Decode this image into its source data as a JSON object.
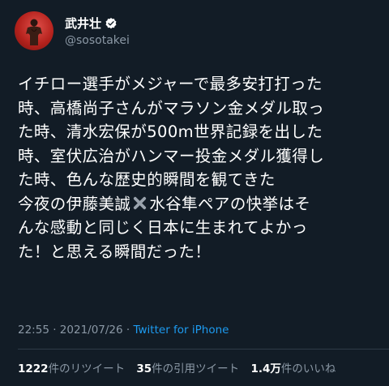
{
  "user": {
    "display_name": "武井壮",
    "handle": "@sosotakei"
  },
  "tweet": {
    "lines": [
      "イチロー選手がメジャーで最多安打打った",
      "時、高橋尚子さんがマラソン金メダル取っ",
      "た時、清水宏保が500m世界記録を出した",
      "時、室伏広治がハンマー投金メダル獲得し",
      "た時、色んな歴史的瞬間を観てきた"
    ],
    "line6_before": "今夜の伊藤美誠",
    "line6_after": "水谷隼ペアの快挙はそ",
    "lines_end": [
      "んな感動と同じく日本に生まれてよかっ",
      "た！と思える瞬間だった！"
    ],
    "emoji_name": "heavy-multiplication-x-icon"
  },
  "meta": {
    "time": "22:55",
    "sep1": "·",
    "date": "2021/07/26",
    "sep2": "·",
    "source": "Twitter for iPhone"
  },
  "stats": {
    "retweets_count": "1222",
    "retweets_label": "件のリツイート",
    "quotes_count": "35",
    "quotes_label": "件の引用ツイート",
    "likes_count": "1.4万",
    "likes_label": "件のいいね"
  },
  "colors": {
    "background": "#121c26",
    "text": "#ffffff",
    "secondary": "#8b98a5",
    "link": "#1d9bf0",
    "avatar_bg": "#b5221d"
  }
}
